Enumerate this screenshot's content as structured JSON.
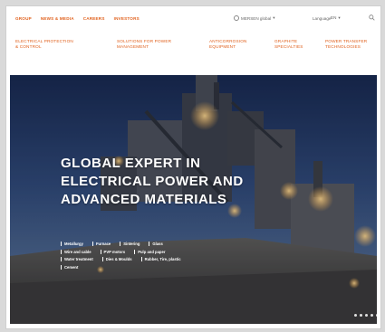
{
  "top_nav": [
    "Group",
    "News & Media",
    "Careers",
    "Investors"
  ],
  "region": {
    "label": "MERSEN global"
  },
  "language": {
    "label": "Language",
    "value": "EN"
  },
  "categories": [
    {
      "line1": "Electrical protection",
      "line2": "& control"
    },
    {
      "line1": "Solutions for power",
      "line2": "management"
    },
    {
      "line1": "Anticorrosion",
      "line2": "equipment"
    },
    {
      "line1": "Graphite",
      "line2": "specialties"
    },
    {
      "line1": "Power transfer",
      "line2": "technologies"
    }
  ],
  "hero": {
    "title_line1": "GLOBAL EXPERT IN",
    "title_line2": "ELECTRICAL POWER AND",
    "title_line3": "ADVANCED MATERIALS",
    "tags": [
      [
        "Metallurgy",
        "Furnace",
        "Sintering",
        "Glass"
      ],
      [
        "Wire and cable",
        "PVP motors",
        "Pulp and paper"
      ],
      [
        "Water treatment",
        "Dies & Moulds",
        "Rubber, Tire, plastic"
      ],
      [
        "Cement"
      ]
    ],
    "slide_count": 5
  },
  "colors": {
    "accent": "#e0601c",
    "hero_sky": "#1f2f52"
  }
}
